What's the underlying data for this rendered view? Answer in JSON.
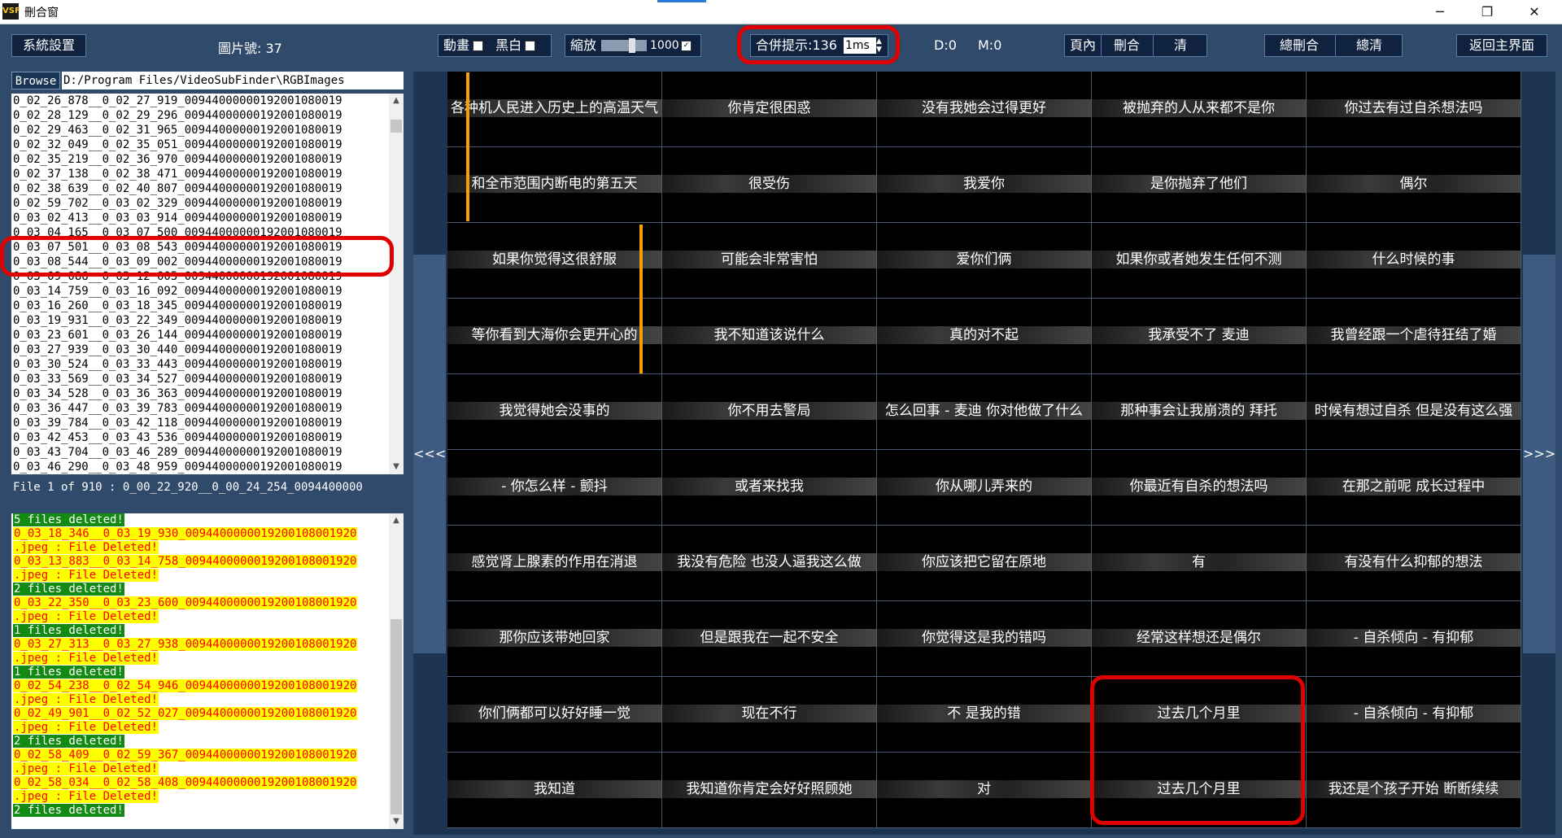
{
  "window": {
    "title": "刪合窗",
    "app_icon": "VSF"
  },
  "toolbar": {
    "settings": "系統設置",
    "pic_count_label": "圖片號: 37",
    "motion": "動畫",
    "bw": "黑白",
    "zoom": "縮放",
    "zoom_value": "1000",
    "merge_hint": "合併提示:136",
    "merge_unit": "1ms",
    "d_label": "D:0",
    "m_label": "M:0",
    "page_in": "頁內",
    "delete_merge": "刪合",
    "clear": "清",
    "total_merge": "總刪合",
    "total_clear": "總清",
    "back": "返回主界面"
  },
  "browse": {
    "button": "Browse",
    "path": "D:/Program Files/VideoSubFinder\\RGBImages"
  },
  "files": [
    "0_02_26_878__0_02_27_919_00944000000192001080019",
    "0_02_28_129__0_02_29_296_00944000000192001080019",
    "0_02_29_463__0_02_31_965_00944000000192001080019",
    "0_02_32_049__0_02_35_051_00944000000192001080019",
    "0_02_35_219__0_02_36_970_00944000000192001080019",
    "0_02_37_138__0_02_38_471_00944000000192001080019",
    "0_02_38_639__0_02_40_807_00944000000192001080019",
    "0_02_59_702__0_03_02_329_00944000000192001080019",
    "0_03_02_413__0_03_03_914_00944000000192001080019",
    "0_03_04_165__0_03_07_500_00944000000192001080019",
    "0_03_07_501__0_03_08_543_00944000000192001080019",
    "0_03_08_544__0_03_09_002_00944000000192001080019",
    "0_03_09_086__0_03_12_005_00944000000192001080019",
    "0_03_14_759__0_03_16_092_00944000000192001080019",
    "0_03_16_260__0_03_18_345_00944000000192001080019",
    "0_03_19_931__0_03_22_349_00944000000192001080019",
    "0_03_23_601__0_03_26_144_00944000000192001080019",
    "0_03_27_939__0_03_30_440_00944000000192001080019",
    "0_03_30_524__0_03_33_443_00944000000192001080019",
    "0_03_33_569__0_03_34_527_00944000000192001080019",
    "0_03_34_528__0_03_36_363_00944000000192001080019",
    "0_03_36_447__0_03_39_783_00944000000192001080019",
    "0_03_39_784__0_03_42_118_00944000000192001080019",
    "0_03_42_453__0_03_43_536_00944000000192001080019",
    "0_03_43_704__0_03_46_289_00944000000192001080019",
    "0_03_46_290__0_03_48_959_00944000000192001080019"
  ],
  "file_info": "File 1 of 910 :   0_00_22_920__0_00_24_254_0094400000",
  "log": [
    {
      "t": "5 files deleted!",
      "c": "green"
    },
    {
      "t": "0_03_18_346__0_03_19_930_0094400000019200108001920",
      "c": "yellow"
    },
    {
      "t": ".jpeg : File Deleted!",
      "c": "yellow"
    },
    {
      "t": "0_03_13_883__0_03_14_758_0094400000019200108001920",
      "c": "yellow"
    },
    {
      "t": ".jpeg : File Deleted!",
      "c": "yellow"
    },
    {
      "t": "2 files deleted!",
      "c": "green"
    },
    {
      "t": "0_03_22_350__0_03_23_600_0094400000019200108001920",
      "c": "yellow"
    },
    {
      "t": ".jpeg : File Deleted!",
      "c": "yellow"
    },
    {
      "t": "1 files deleted!",
      "c": "green"
    },
    {
      "t": "0_03_27_313__0_03_27_938_0094400000019200108001920",
      "c": "yellow"
    },
    {
      "t": ".jpeg : File Deleted!",
      "c": "yellow"
    },
    {
      "t": "1 files deleted!",
      "c": "green"
    },
    {
      "t": "0_02_54_238__0_02_54_946_0094400000019200108001920",
      "c": "yellow"
    },
    {
      "t": ".jpeg : File Deleted!",
      "c": "yellow"
    },
    {
      "t": "0_02_49_901__0_02_52_027_0094400000019200108001920",
      "c": "yellow"
    },
    {
      "t": ".jpeg : File Deleted!",
      "c": "yellow"
    },
    {
      "t": "2 files deleted!",
      "c": "green"
    },
    {
      "t": "0_02_58_409__0_02_59_367_0094400000019200108001920",
      "c": "yellow"
    },
    {
      "t": ".jpeg : File Deleted!",
      "c": "yellow"
    },
    {
      "t": "0_02_58_034__0_02_58_408_0094400000019200108001920",
      "c": "yellow"
    },
    {
      "t": ".jpeg : File Deleted!",
      "c": "yellow"
    },
    {
      "t": "2 files deleted!",
      "c": "green"
    }
  ],
  "nav": {
    "prev": "<<<",
    "next": ">>>"
  },
  "subtitles": [
    "各种机人民进入历史上的高温天气",
    "你肯定很困惑",
    "没有我她会过得更好",
    "被抛弃的人从来都不是你",
    "你过去有过自杀想法吗",
    "和全市范围内断电的第五天",
    "很受伤",
    "我爱你",
    "是你抛弃了他们",
    "偶尔",
    "如果你觉得这很舒服",
    "可能会非常害怕",
    "爱你们俩",
    "如果你或者她发生任何不测",
    "什么时候的事",
    "等你看到大海你会更开心的",
    "我不知道该说什么",
    "真的对不起",
    "我承受不了 麦迪",
    "我曾经跟一个虐待狂结了婚",
    "我觉得她会没事的",
    "你不用去警局",
    "怎么回事 - 麦迪 你对他做了什么",
    "那种事会让我崩溃的 拜托",
    "时候有想过自杀 但是没有这么强",
    "- 你怎么样 - 颤抖",
    "或者来找我",
    "你从哪儿弄来的",
    "你最近有自杀的想法吗",
    "在那之前呢 成长过程中",
    "感觉肾上腺素的作用在消退",
    "我没有危险 也没人逼我这么做",
    "你应该把它留在原地",
    "有",
    "有没有什么抑郁的想法",
    "那你应该带她回家",
    "但是跟我在一起不安全",
    "你觉得这是我的错吗",
    "经常这样想还是偶尔",
    "- 自杀倾向 - 有抑郁",
    "你们俩都可以好好睡一觉",
    "现在不行",
    "不 是我的错",
    "过去几个月里",
    "- 自杀倾向 - 有抑郁",
    "我知道",
    "我知道你肯定会好好照顾她",
    "对",
    "过去几个月里",
    "我还是个孩子开始 断断续续"
  ]
}
